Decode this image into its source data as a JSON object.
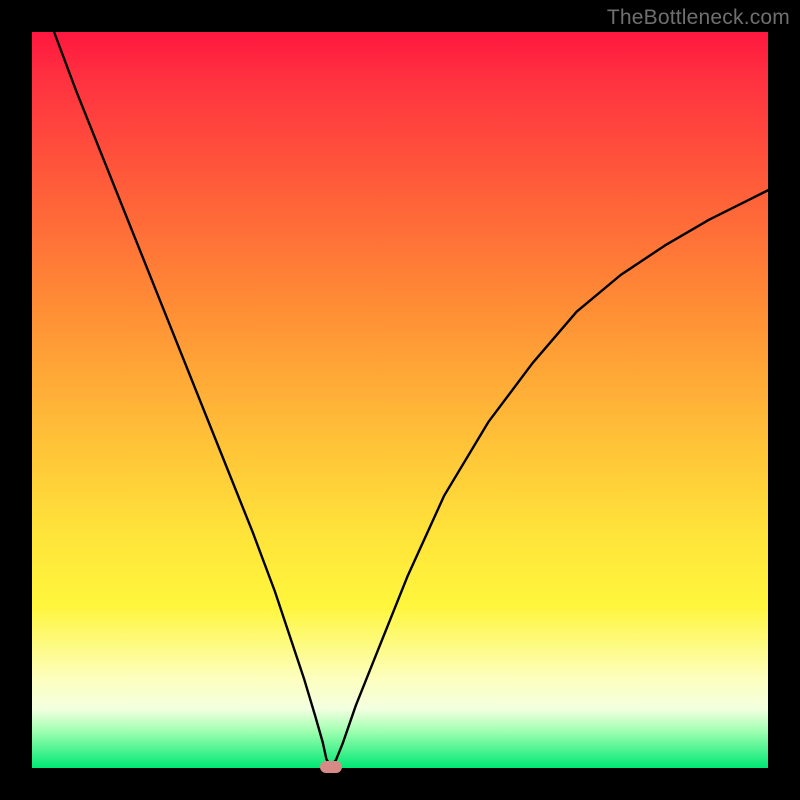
{
  "watermark": "TheBottleneck.com",
  "chart_data": {
    "type": "line",
    "title": "",
    "xlabel": "",
    "ylabel": "",
    "xlim": [
      0,
      100
    ],
    "ylim": [
      0,
      100
    ],
    "grid": false,
    "legend": false,
    "series": [
      {
        "name": "curve",
        "x": [
          3,
          6,
          10,
          14,
          18,
          22,
          26,
          30,
          33,
          35,
          37,
          38.5,
          39.5,
          40,
          40.6,
          41.3,
          42.2,
          44,
          47,
          51,
          56,
          62,
          68,
          74,
          80,
          86,
          92,
          97,
          100
        ],
        "y": [
          100,
          92,
          82,
          72,
          62,
          52,
          42,
          32,
          24,
          18,
          12,
          7,
          3.5,
          1.2,
          0.2,
          1.1,
          3.3,
          8.5,
          16,
          26,
          37,
          47,
          55,
          62,
          67,
          71,
          74.5,
          77,
          78.5
        ]
      }
    ],
    "annotations": [
      {
        "name": "marker",
        "x": 40.6,
        "y": 0.2,
        "color": "#d88b86",
        "shape": "pill"
      }
    ],
    "background_gradient": {
      "direction": "vertical",
      "stops": [
        {
          "pos": 0.0,
          "color": "#ff173f"
        },
        {
          "pos": 0.38,
          "color": "#ff8f35"
        },
        {
          "pos": 0.68,
          "color": "#ffe33a"
        },
        {
          "pos": 0.88,
          "color": "#fdffc0"
        },
        {
          "pos": 1.0,
          "color": "#00e874"
        }
      ]
    }
  }
}
